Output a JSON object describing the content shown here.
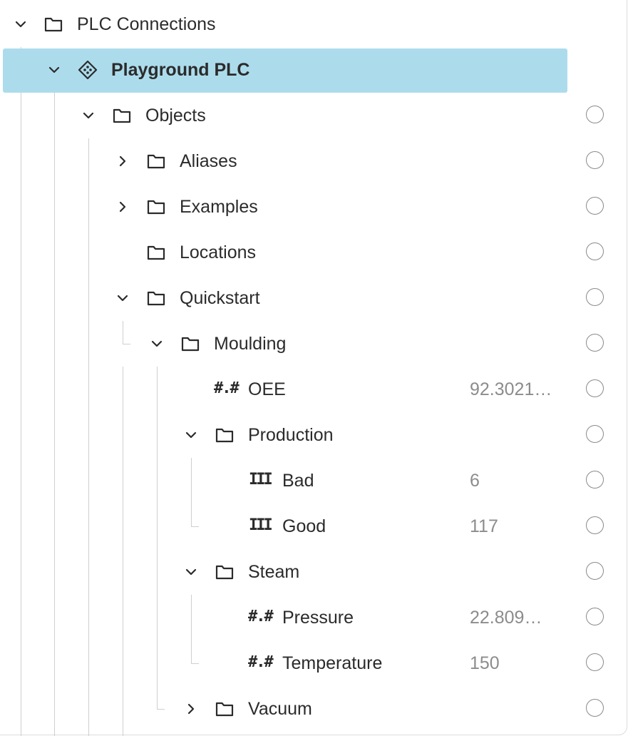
{
  "icons": {
    "expanded": "chevron-down-icon",
    "collapsed": "chevron-right-icon",
    "folder": "folder-icon",
    "plc": "plc-diamond-icon",
    "number_glyph": "#.#",
    "integer_glyph": "III",
    "radio": "radio-circle-icon"
  },
  "colors": {
    "selection_background": "#acdcec",
    "value_text": "#8c8c8c",
    "tree_guide": "#cfcfcf"
  },
  "tree": {
    "root": {
      "label": "PLC Connections",
      "state": "expanded"
    },
    "plc": {
      "label": "Playground PLC",
      "state": "expanded",
      "selected": true
    },
    "objects": {
      "label": "Objects",
      "state": "expanded"
    },
    "aliases": {
      "label": "Aliases",
      "state": "collapsed"
    },
    "examples": {
      "label": "Examples",
      "state": "collapsed"
    },
    "locations": {
      "label": "Locations"
    },
    "quickstart": {
      "label": "Quickstart",
      "state": "expanded"
    },
    "moulding": {
      "label": "Moulding",
      "state": "expanded"
    },
    "oee": {
      "label": "OEE",
      "value": "92.30214444444",
      "type_glyph": "#.#"
    },
    "production": {
      "label": "Production",
      "state": "expanded"
    },
    "bad": {
      "label": "Bad",
      "value": "6",
      "type_glyph": "III"
    },
    "good": {
      "label": "Good",
      "value": "117",
      "type_glyph": "III"
    },
    "steam": {
      "label": "Steam",
      "state": "expanded"
    },
    "pressure": {
      "label": "Pressure",
      "value": "22.8094444444",
      "type_glyph": "#.#"
    },
    "temperature": {
      "label": "Temperature",
      "value": "150",
      "type_glyph": "#.#"
    },
    "vacuum": {
      "label": "Vacuum",
      "state": "collapsed"
    }
  }
}
